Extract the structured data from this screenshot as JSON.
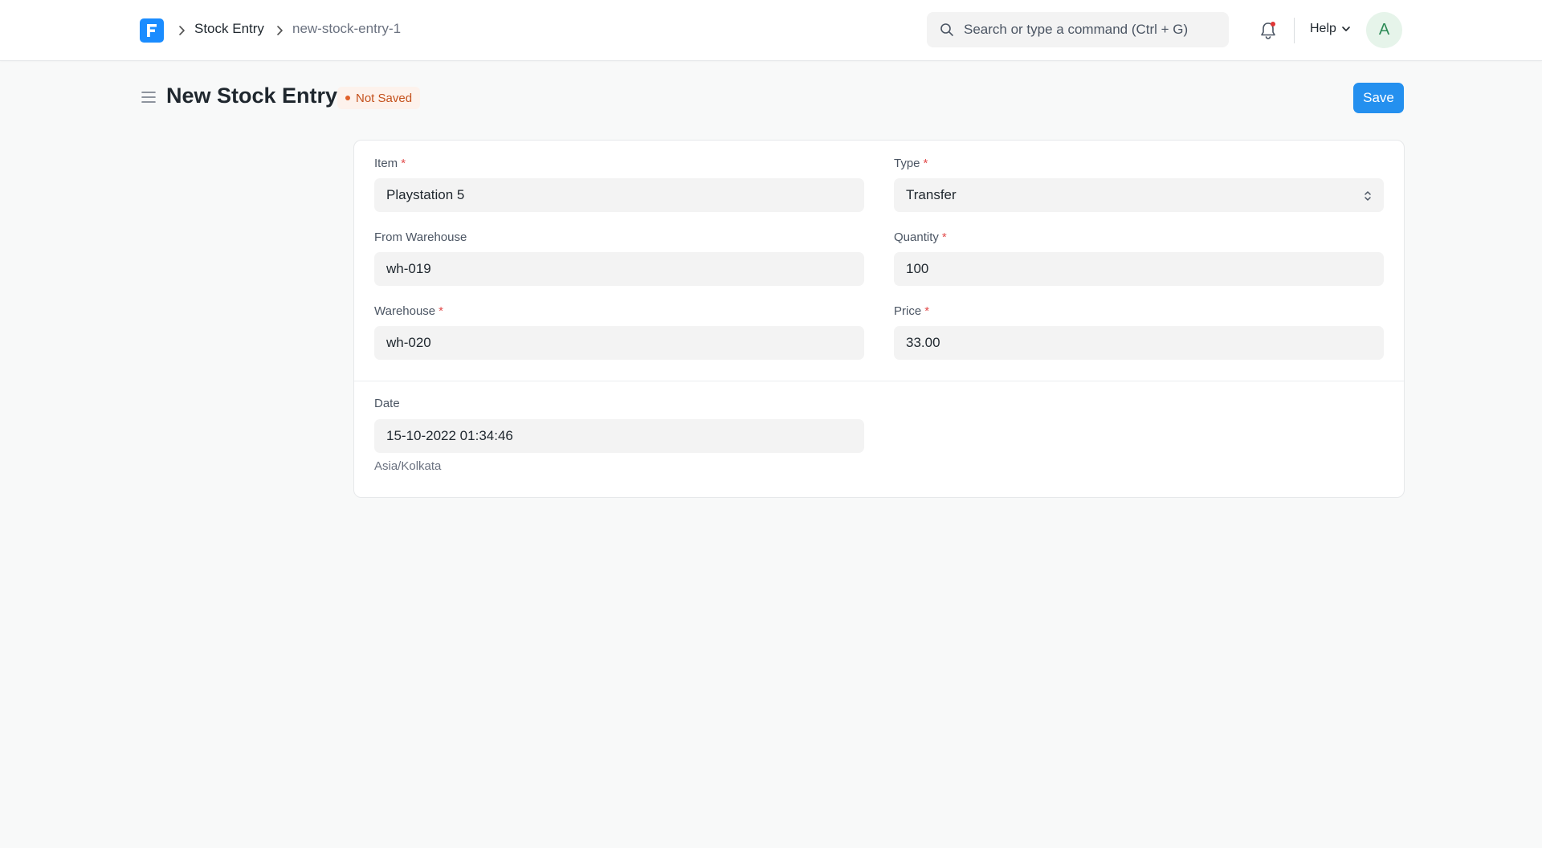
{
  "navbar": {
    "logo_icon": "frappe-logo-icon",
    "breadcrumbs": [
      "Stock Entry",
      "new-stock-entry-1"
    ],
    "search": {
      "placeholder": "Search or type a command (Ctrl + G)"
    },
    "help_label": "Help",
    "avatar_initial": "A"
  },
  "page": {
    "title": "New Stock Entry",
    "status": "Not Saved",
    "save_label": "Save"
  },
  "form": {
    "item": {
      "label": "Item",
      "value": "Playstation 5"
    },
    "type": {
      "label": "Type",
      "value": "Transfer"
    },
    "from_warehouse": {
      "label": "From Warehouse",
      "value": "wh-019"
    },
    "quantity": {
      "label": "Quantity",
      "value": "100"
    },
    "warehouse": {
      "label": "Warehouse",
      "value": "wh-020"
    },
    "price": {
      "label": "Price",
      "value": "33.00"
    },
    "date": {
      "label": "Date",
      "value": "15-10-2022 01:34:46",
      "timezone": "Asia/Kolkata"
    },
    "required_marker": "*"
  },
  "colors": {
    "primary": "#2490ef",
    "status_text": "#c4511c",
    "required": "#e24c4c"
  }
}
